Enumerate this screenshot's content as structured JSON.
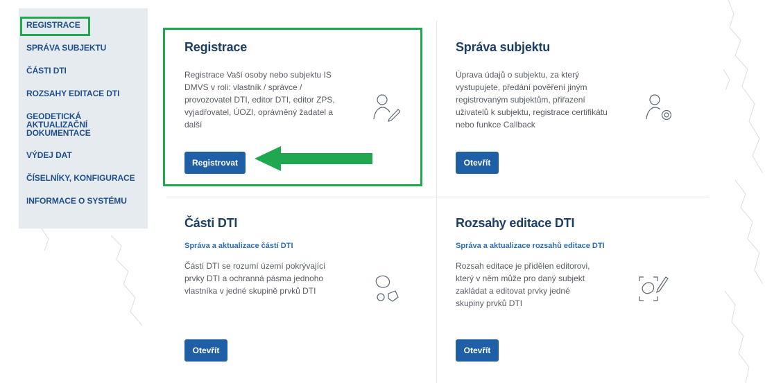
{
  "sidebar": {
    "items": [
      {
        "label": "REGISTRACE"
      },
      {
        "label": "SPRÁVA SUBJEKTU"
      },
      {
        "label": "ČÁSTI DTI"
      },
      {
        "label": "ROZSAHY EDITACE DTI"
      },
      {
        "label": "GEODETICKÁ AKTUALIZAČNÍ DOKUMENTACE"
      },
      {
        "label": "VÝDEJ DAT"
      },
      {
        "label": "ČÍSELNÍKY, KONFIGURACE"
      },
      {
        "label": "INFORMACE O SYSTÉMU"
      }
    ]
  },
  "cards": {
    "registrace": {
      "title": "Registrace",
      "text": "Registrace Vaší osoby nebo subjektu IS DMVS v roli: vlastník / správce / provozovatel DTI, editor DTI, editor ZPS, vyjadřovatel, ÚOZI, oprávněný žadatel a další",
      "button": "Registrovat",
      "icon": "user-edit-icon"
    },
    "sprava": {
      "title": "Správa subjektu",
      "text": "Úprava údajů o subjektu, za který vystupujete, předání pověření jiným registrovaným subjektům, přiřazení uživatelů k subjektu, registrace certifikátu nebo funkce Callback",
      "button": "Otevřít",
      "icon": "user-settings-icon"
    },
    "casti": {
      "title": "Části DTI",
      "subtitle": "Správa a aktualizace částí DTI",
      "text": "Částí DTI se rozumí území pokrývající prvky DTI a ochranná pásma jednoho vlastníka v jedné skupině prvků DTI",
      "button": "Otevřít",
      "icon": "shapes-icon"
    },
    "rozsahy": {
      "title": "Rozsahy editace DTI",
      "subtitle": "Správa a aktualizace rozsahů editace DTI",
      "text": "Rozsah editace je přidělen editorovi, který v něm může pro daný subjekt zakládat a editovat prvky jedné skupiny prvků DTI",
      "button": "Otevřít",
      "icon": "area-edit-icon"
    }
  },
  "colors": {
    "accent": "#1f5fa6",
    "highlight": "#1fa84f",
    "title": "#1d3e66"
  }
}
